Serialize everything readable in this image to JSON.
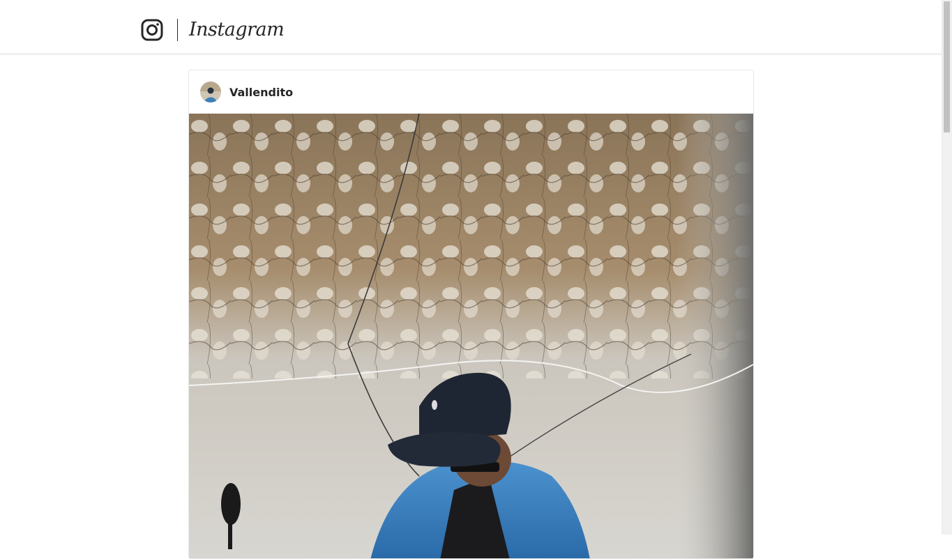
{
  "header": {
    "logo_icon": "instagram-camera-icon",
    "wordmark": "Instagram"
  },
  "post": {
    "username": "Vallendito",
    "avatar_icon": "user-avatar",
    "image": "photo-of-man-in-cap-and-denim-jacket-against-weathered-wall"
  },
  "colors": {
    "text": "#262626",
    "border": "#dbdbdb",
    "background": "#ffffff"
  }
}
